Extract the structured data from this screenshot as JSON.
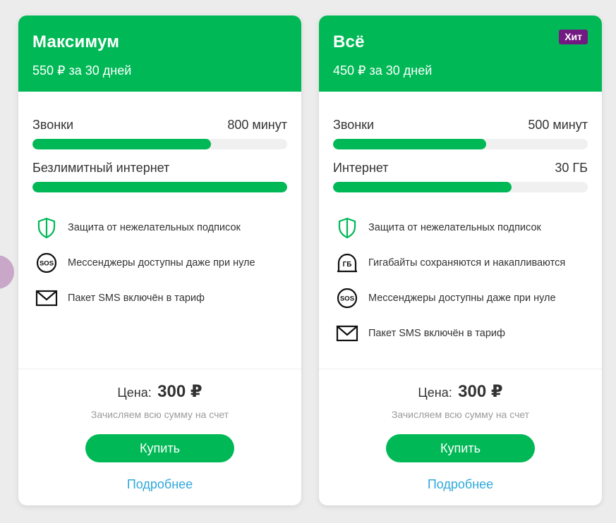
{
  "colors": {
    "brand_green": "#00b956",
    "hit_purple": "#731982",
    "link_blue": "#2fa8dc",
    "bar_track": "#f0f0f0"
  },
  "cards": [
    {
      "title": "Максимум",
      "price_period": "550 ₽ за 30 дней",
      "badge": "",
      "limits": [
        {
          "label": "Звонки",
          "value": "800 минут",
          "fill_fraction": 0.7
        },
        {
          "label": "Безлимитный интернет",
          "value": "",
          "fill_fraction": 1.0
        }
      ],
      "features": [
        {
          "icon": "shield-icon",
          "text": "Защита от нежелательных подписок"
        },
        {
          "icon": "sos-icon",
          "text": "Мессенджеры доступны даже при нуле"
        },
        {
          "icon": "envelope-icon",
          "text": "Пакет SMS включён в тариф"
        }
      ],
      "price_label": "Цена:",
      "price_value": "300 ₽",
      "price_note": "Зачисляем всю сумму на счет",
      "buy_label": "Купить",
      "more_label": "Подробнее"
    },
    {
      "title": "Всё",
      "price_period": "450 ₽ за 30 дней",
      "badge": "Хит",
      "limits": [
        {
          "label": "Звонки",
          "value": "500 минут",
          "fill_fraction": 0.6
        },
        {
          "label": "Интернет",
          "value": "30 ГБ",
          "fill_fraction": 0.7
        }
      ],
      "features": [
        {
          "icon": "shield-icon",
          "text": "Защита от нежелательных подписок"
        },
        {
          "icon": "gb-icon",
          "text": "Гигабайты сохраняются и накапливаются"
        },
        {
          "icon": "sos-icon",
          "text": "Мессенджеры доступны даже при нуле"
        },
        {
          "icon": "envelope-icon",
          "text": "Пакет SMS включён в тариф"
        }
      ],
      "price_label": "Цена:",
      "price_value": "300 ₽",
      "price_note": "Зачисляем всю сумму на счет",
      "buy_label": "Купить",
      "more_label": "Подробнее"
    }
  ]
}
